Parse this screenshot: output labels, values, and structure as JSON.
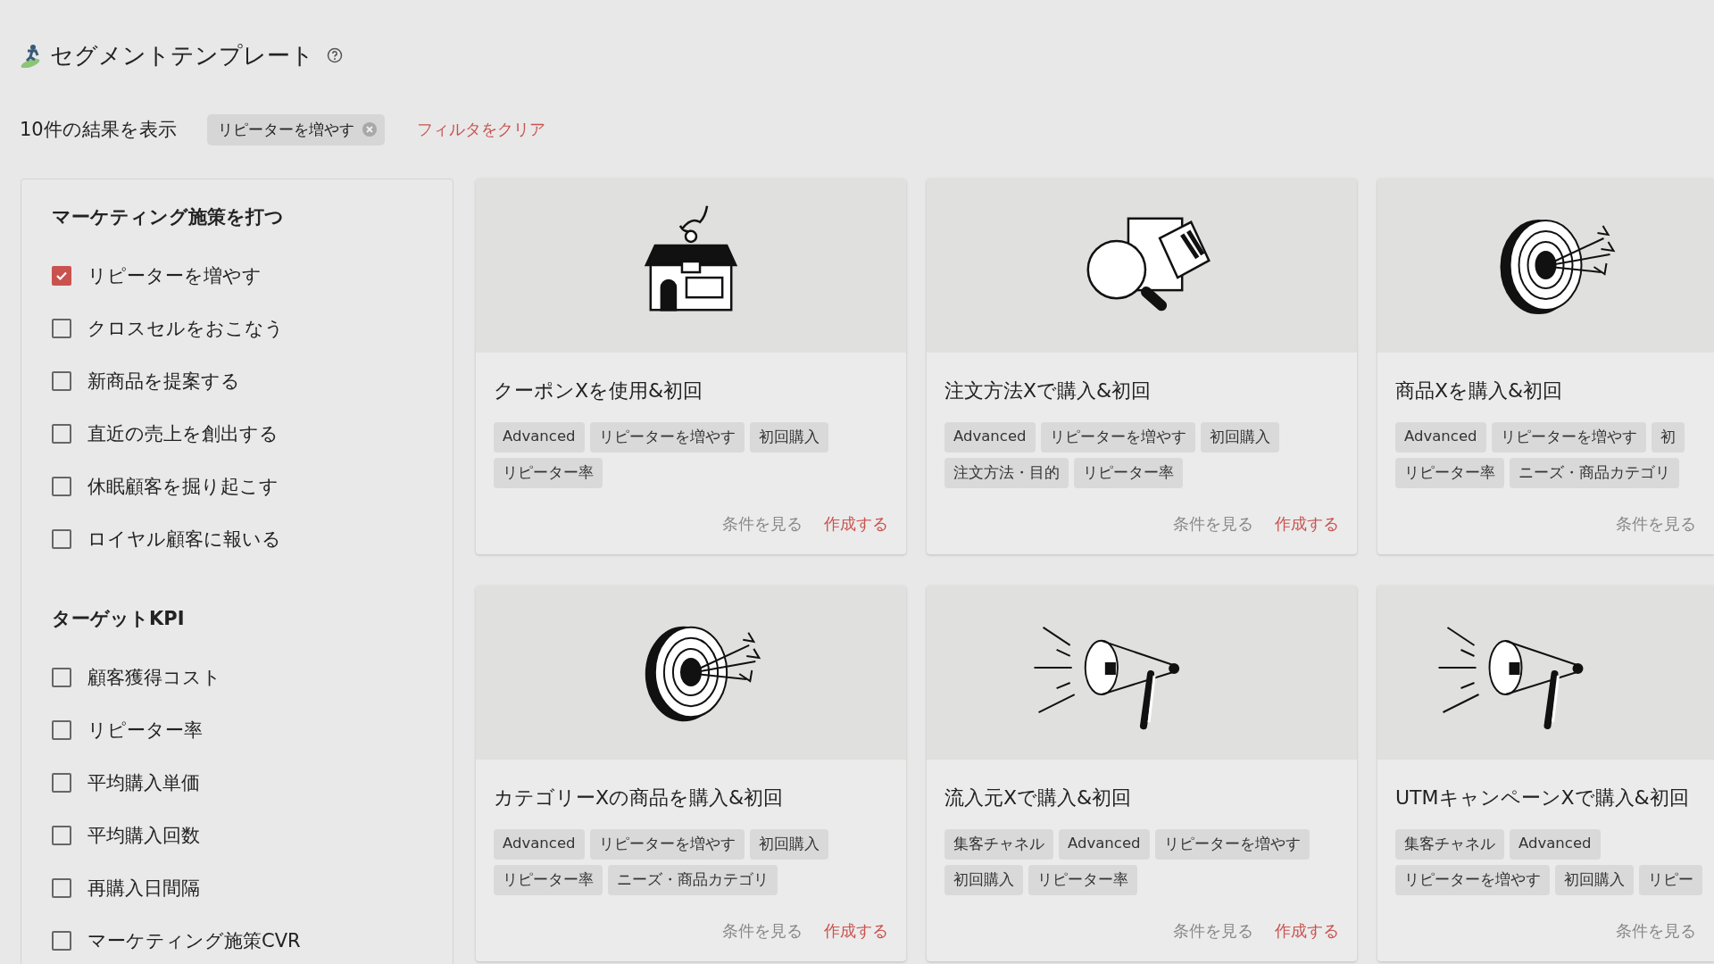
{
  "page": {
    "title": "セグメントテンプレート"
  },
  "filter_bar": {
    "result_count": "10件の結果を表示",
    "active_filters": [
      {
        "label": "リピーターを増やす"
      }
    ],
    "clear_link": "フィルタをクリア"
  },
  "sidebar": {
    "groups": [
      {
        "heading": "マーケティング施策を打つ",
        "options": [
          {
            "label": "リピーターを増やす",
            "checked": true
          },
          {
            "label": "クロスセルをおこなう",
            "checked": false
          },
          {
            "label": "新商品を提案する",
            "checked": false
          },
          {
            "label": "直近の売上を創出する",
            "checked": false
          },
          {
            "label": "休眠顧客を掘り起こす",
            "checked": false
          },
          {
            "label": "ロイヤル顧客に報いる",
            "checked": false
          }
        ]
      },
      {
        "heading": "ターゲットKPI",
        "options": [
          {
            "label": "顧客獲得コスト",
            "checked": false
          },
          {
            "label": "リピーター率",
            "checked": false
          },
          {
            "label": "平均購入単価",
            "checked": false
          },
          {
            "label": "平均購入回数",
            "checked": false
          },
          {
            "label": "再購入日間隔",
            "checked": false
          },
          {
            "label": "マーケティング施策CVR",
            "checked": false
          }
        ]
      }
    ]
  },
  "cards": [
    {
      "kind": "shop",
      "title": "クーポンXを使用&初回",
      "tags": [
        "Advanced",
        "リピーターを増やす",
        "初回購入",
        "リピーター率"
      ],
      "view_link": "条件を見る",
      "create_link": "作成する"
    },
    {
      "kind": "search-boxes",
      "title": "注文方法Xで購入&初回",
      "tags": [
        "Advanced",
        "リピーターを増やす",
        "初回購入",
        "注文方法・目的",
        "リピーター率"
      ],
      "view_link": "条件を見る",
      "create_link": "作成する"
    },
    {
      "kind": "target",
      "title": "商品Xを購入&初回",
      "tags": [
        "Advanced",
        "リピーターを増やす",
        "初",
        "リピーター率",
        "ニーズ・商品カテゴリ"
      ],
      "view_link": "条件を見る"
    },
    {
      "kind": "target",
      "title": "カテゴリーXの商品を購入&初回",
      "tags": [
        "Advanced",
        "リピーターを増やす",
        "初回購入",
        "リピーター率",
        "ニーズ・商品カテゴリ"
      ],
      "view_link": "条件を見る",
      "create_link": "作成する"
    },
    {
      "kind": "megaphone",
      "title": "流入元Xで購入&初回",
      "tags": [
        "集客チャネル",
        "Advanced",
        "リピーターを増やす",
        "初回購入",
        "リピーター率"
      ],
      "view_link": "条件を見る",
      "create_link": "作成する"
    },
    {
      "kind": "megaphone",
      "title": "UTMキャンペーンXで購入&初回",
      "tags": [
        "集客チャネル",
        "Advanced",
        "リピーターを増やす",
        "初回購入",
        "リピー"
      ],
      "view_link": "条件を見る"
    }
  ]
}
